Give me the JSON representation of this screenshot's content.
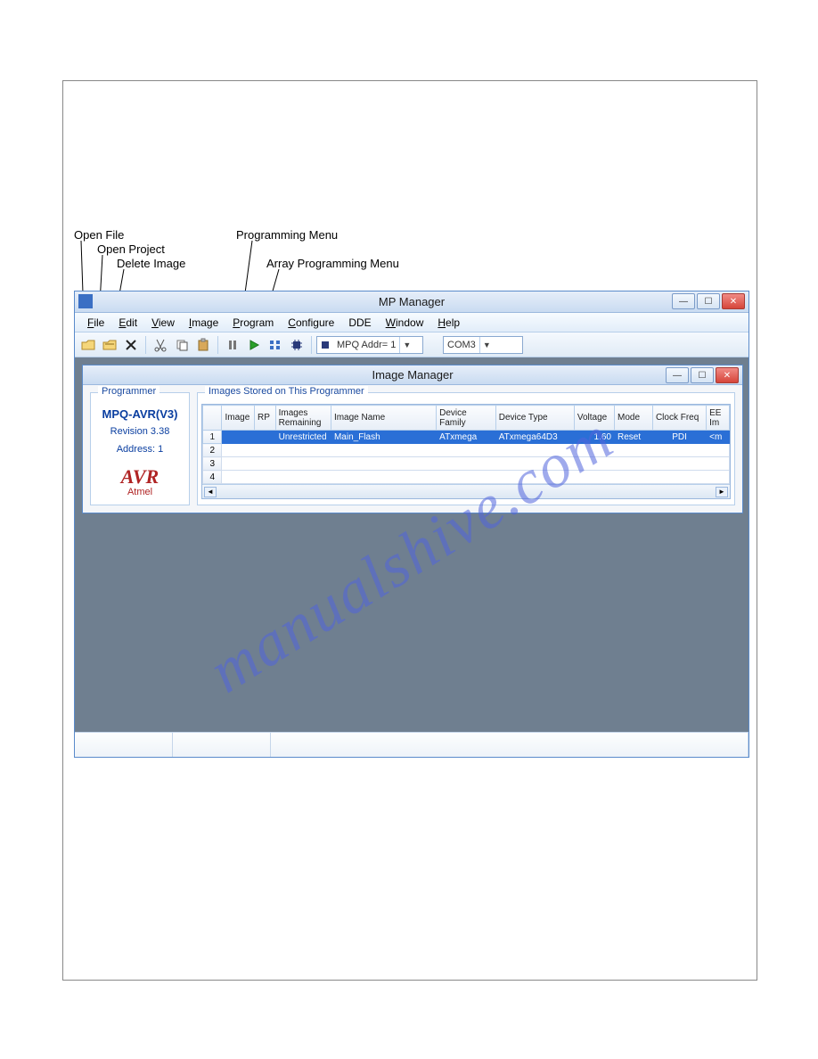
{
  "callouts": {
    "open_file": "Open File",
    "open_project": "Open Project",
    "delete_image": "Delete Image",
    "programming_menu": "Programming Menu",
    "array_programming_menu": "Array Programming Menu"
  },
  "main_window": {
    "title": "MP Manager",
    "menu": [
      "File",
      "Edit",
      "View",
      "Image",
      "Program",
      "Configure",
      "DDE",
      "Window",
      "Help"
    ],
    "addr_combo": "MPQ Addr= 1",
    "com_combo": "COM3"
  },
  "child_window": {
    "title": "Image Manager",
    "programmer_panel": {
      "legend": "Programmer",
      "name": "MPQ-AVR(V3)",
      "revision": "Revision 3.38",
      "address": "Address: 1",
      "logo": "AVR",
      "brand": "Atmel"
    },
    "grid_panel": {
      "legend": "Images Stored on This Programmer",
      "columns": [
        "Image",
        "RP",
        "Images Remaining",
        "Image Name",
        "Device Family",
        "Device Type",
        "Voltage",
        "Mode",
        "Clock Freq",
        "EE Im"
      ],
      "row_headers": [
        "1",
        "2",
        "3",
        "4"
      ],
      "rows": [
        {
          "rp": "",
          "remaining": "Unrestricted",
          "name": "Main_Flash",
          "family": "ATxmega",
          "type": "ATxmega64D3",
          "voltage": "1.60",
          "mode": "Reset",
          "clock": "PDI",
          "ee": "<m"
        }
      ]
    }
  },
  "watermark": "manualshive.com"
}
